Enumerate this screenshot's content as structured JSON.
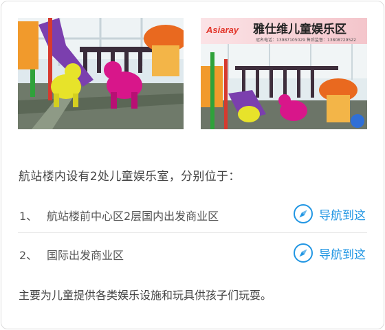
{
  "photos": [
    {
      "alt": "Children's play area with yellow and pink animal rockers and a slide"
    },
    {
      "sign_brand": "Asiaray",
      "sign_title": "雅仕维儿童娱乐区",
      "sign_contact": "冠名电话：13987105029    售后监督：13808729522"
    }
  ],
  "intro": "航站楼内设有2处儿童娱乐室，分别位于：",
  "locations": [
    {
      "num": "1、",
      "name": "航站楼前中心区2层国内出发商业区",
      "nav_label": "导航到这"
    },
    {
      "num": "2、",
      "name": "国际出发商业区",
      "nav_label": "导航到这"
    }
  ],
  "footer": "主要为儿童提供各类娱乐设施和玩具供孩子们玩耍。",
  "colors": {
    "accent": "#2196e3",
    "text": "#444444",
    "border": "#dcdcdc"
  },
  "icons": {
    "nav": "compass-icon"
  }
}
